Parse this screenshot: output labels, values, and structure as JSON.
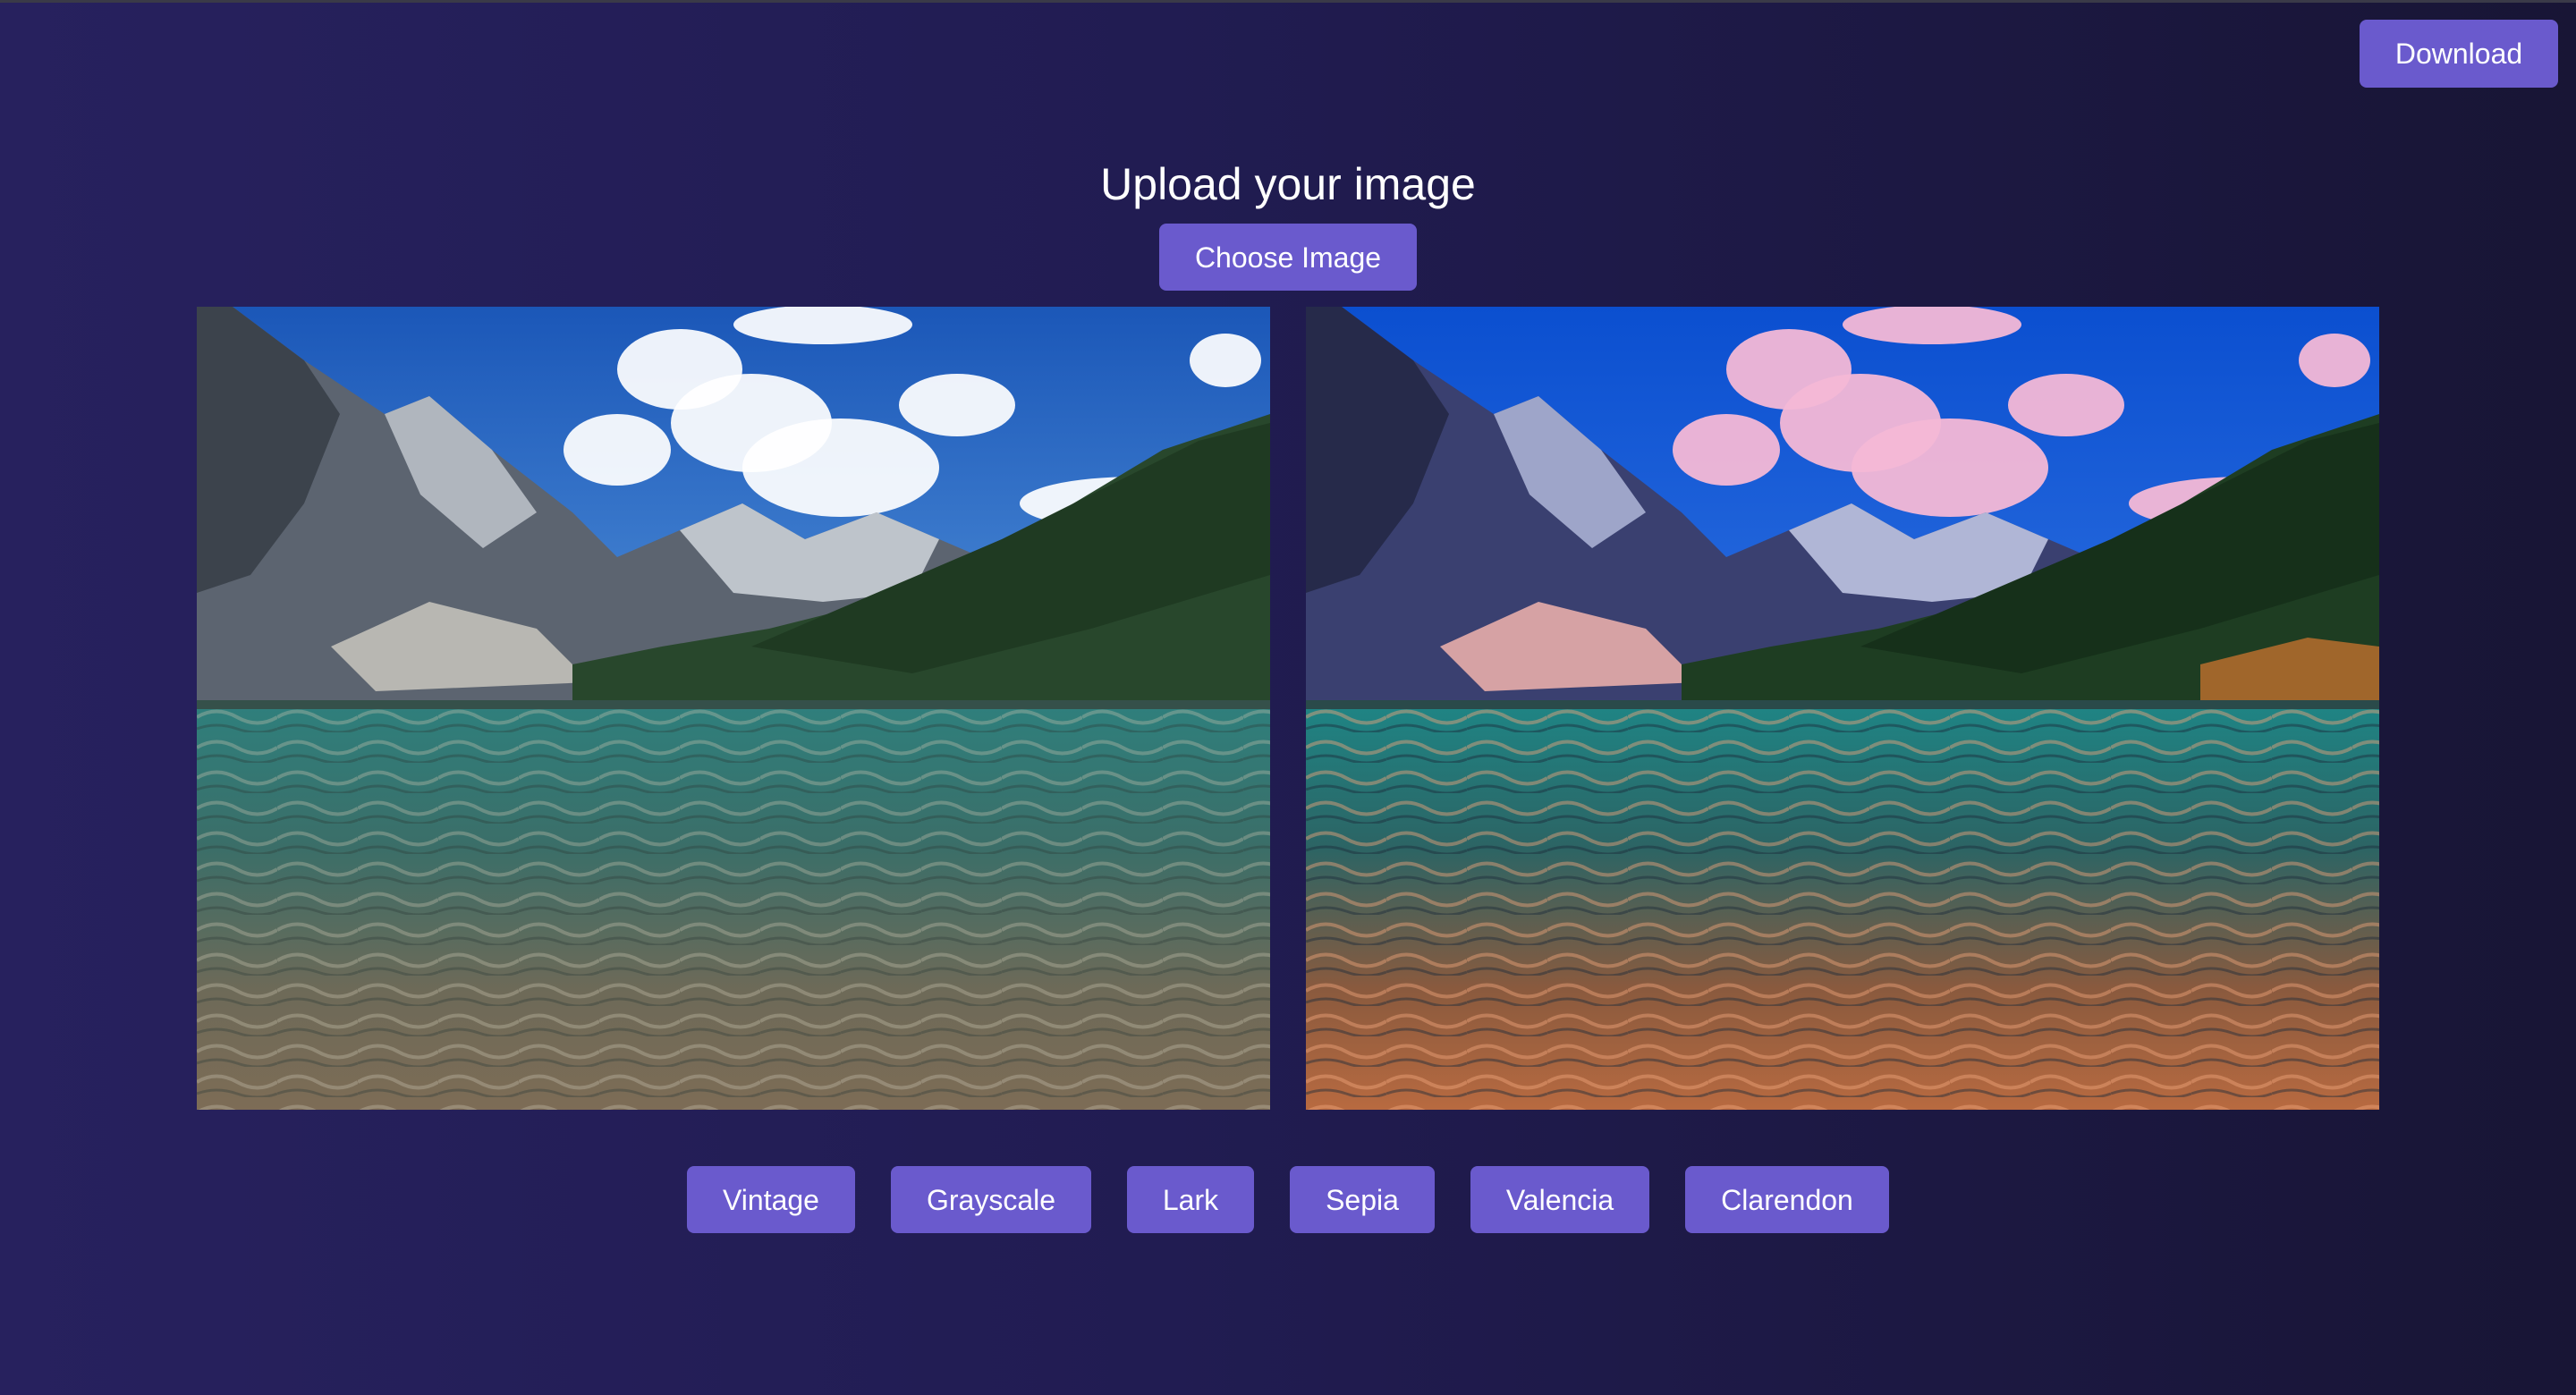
{
  "header": {
    "download_label": "Download"
  },
  "upload": {
    "title": "Upload your image",
    "choose_label": "Choose Image"
  },
  "preview": {
    "original_image": "mountain-lake-photo",
    "filtered_image": "mountain-lake-photo-filtered"
  },
  "filters": [
    {
      "label": "Vintage"
    },
    {
      "label": "Grayscale"
    },
    {
      "label": "Lark"
    },
    {
      "label": "Sepia"
    },
    {
      "label": "Valencia"
    },
    {
      "label": "Clarendon"
    }
  ],
  "colors": {
    "accent": "#6a5acd",
    "background_start": "#27215e",
    "background_end": "#181535",
    "text": "#ffffff"
  }
}
